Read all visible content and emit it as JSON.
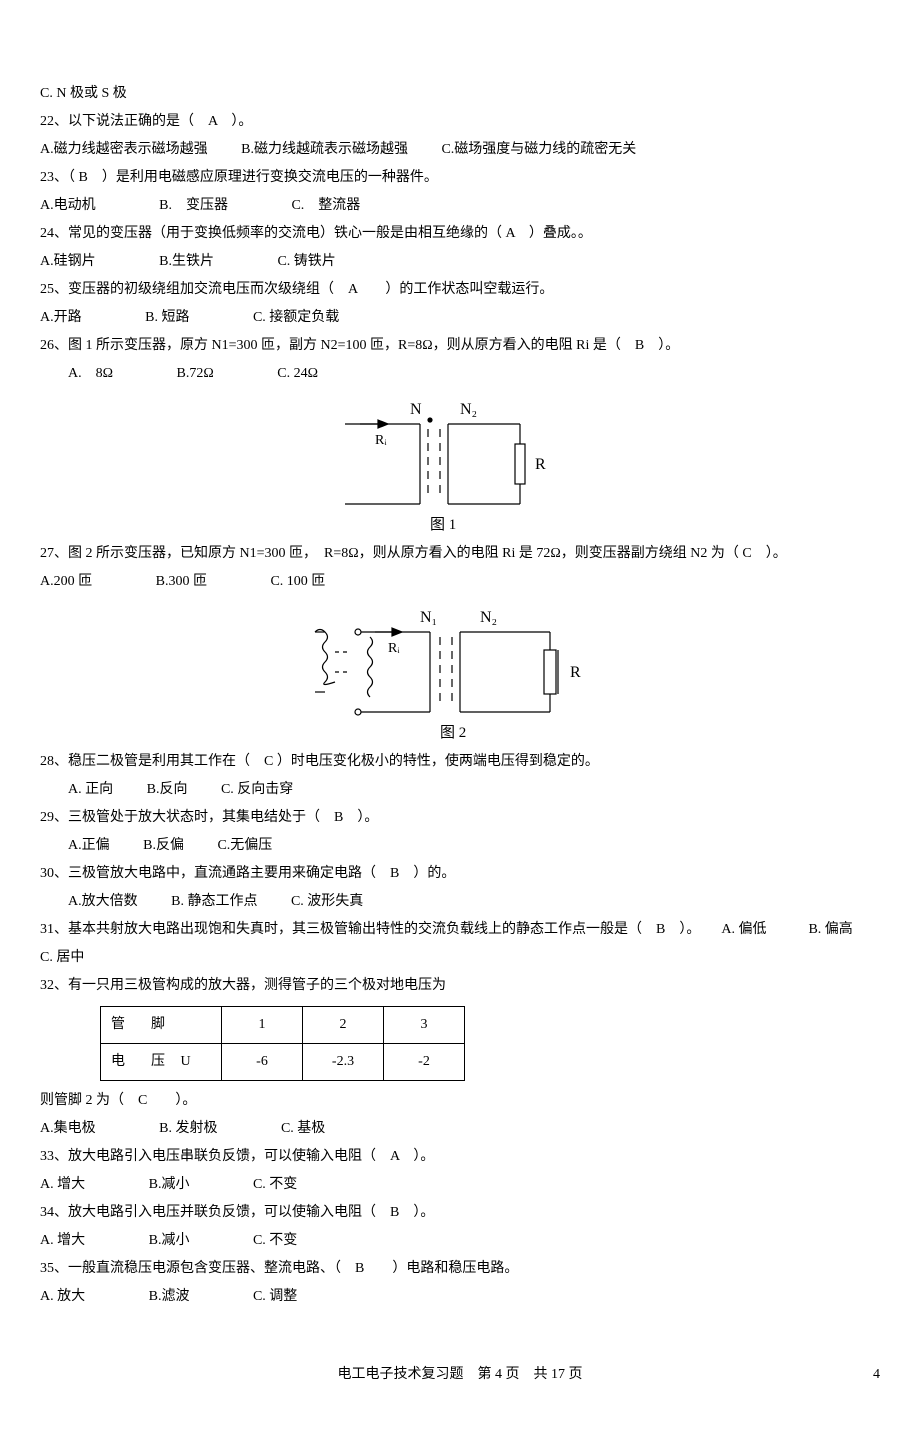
{
  "q21c": "C. N 极或 S 极",
  "q22": {
    "stem": "22、以下说法正确的是（　A　）。",
    "A": "A.磁力线越密表示磁场越强",
    "B": "B.磁力线越疏表示磁场越强",
    "C": "C.磁场强度与磁力线的疏密无关"
  },
  "q23": {
    "stem": "23、（ B　）是利用电磁感应原理进行变换交流电压的一种器件。",
    "A": "A.电动机",
    "B": "B.　变压器",
    "C": "C.　整流器"
  },
  "q24": {
    "stem": "24、常见的变压器（用于变换低频率的交流电）铁心一般是由相互绝缘的（ A　）叠成。。",
    "A": "A.硅钢片",
    "B": "B.生铁片",
    "C": "C. 铸铁片"
  },
  "q25": {
    "stem": "25、变压器的初级绕组加交流电压而次级绕组（　A　　）的工作状态叫空载运行。",
    "A": "A.开路",
    "B": "B. 短路",
    "C": "C. 接额定负载"
  },
  "q26": {
    "stem": "26、图 1 所示变压器，原方 N1=300 匝，副方 N2=100 匝，R=8Ω，则从原方看入的电阻 Ri 是（　B　）。",
    "A": "A.　8Ω",
    "B": "B.72Ω",
    "C": "C. 24Ω",
    "fig": {
      "N": "N",
      "N2": "N₂",
      "Ri": "Rᵢ",
      "R": "R",
      "cap": "图 1"
    }
  },
  "q27": {
    "stem": "27、图 2 所示变压器，已知原方 N1=300 匝，　R=8Ω，则从原方看入的电阻 Ri 是 72Ω，则变压器副方绕组 N2 为（ C　）。",
    "A": "A.200 匝",
    "B": "B.300 匝",
    "C": "C. 100 匝",
    "fig": {
      "N1": "N₁",
      "N2": "N₂",
      "Ri": "Rᵢ",
      "R": "R",
      "cap": "图 2"
    }
  },
  "q28": {
    "stem": "28、稳压二极管是利用其工作在（　C ）时电压变化极小的特性，使两端电压得到稳定的。",
    "A": "A. 正向",
    "B": "B.反向",
    "C": "C. 反向击穿"
  },
  "q29": {
    "stem": "29、三极管处于放大状态时，其集电结处于（　B　）。",
    "A": "A.正偏",
    "B": "B.反偏",
    "C": "C.无偏压"
  },
  "q30": {
    "stem": "30、三极管放大电路中，直流通路主要用来确定电路（　B　）的。",
    "A": "A.放大倍数",
    "B": "B. 静态工作点",
    "C": "C. 波形失真"
  },
  "q31": {
    "stem": "31、基本共射放大电路出现饱和失真时，其三极管输出特性的交流负载线上的静态工作点一般是（　B　）。　　A. 偏低　　　B. 偏高　　C. 居中"
  },
  "q32": {
    "stem": "32、有一只用三极管构成的放大器，测得管子的三个极对地电压为",
    "table": {
      "h0": "管　脚",
      "h1": "1",
      "h2": "2",
      "h3": "3",
      "r0": "电　压 U",
      "r1": "-6",
      "r2": "-2.3",
      "r3": "-2"
    },
    "tail": "则管脚 2 为（　C　　）。",
    "A": "A.集电极",
    "B": "B. 发射极",
    "C": "C. 基极"
  },
  "q33": {
    "stem": "33、放大电路引入电压串联负反馈，可以使输入电阻（　A　）。",
    "A": "A. 增大",
    "B": "B.减小",
    "C": "C. 不变"
  },
  "q34": {
    "stem": "34、放大电路引入电压并联负反馈，可以使输入电阻（　B　）。",
    "A": "A. 增大",
    "B": "B.减小",
    "C": "C. 不变"
  },
  "q35": {
    "stem": "35、一般直流稳压电源包含变压器、整流电路、（　B　　）电路和稳压电路。",
    "A": "A. 放大",
    "B": "B.滤波",
    "C": "C. 调整"
  },
  "footer": {
    "center": "电工电子技术复习题　第 4 页　共 17 页",
    "right": "4"
  }
}
